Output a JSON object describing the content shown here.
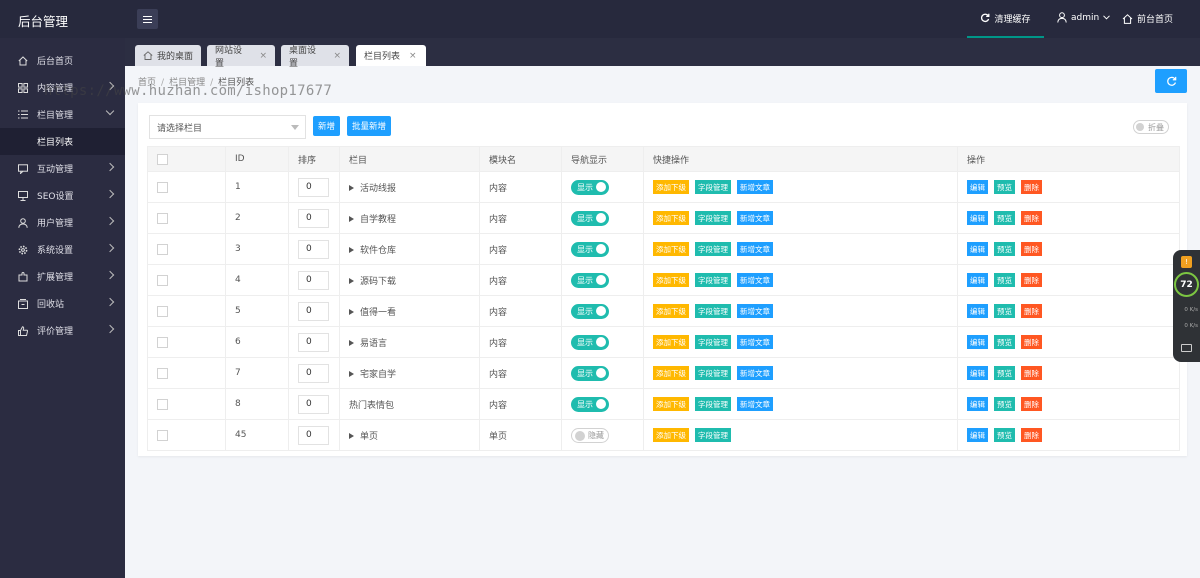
{
  "app": {
    "title": "后台管理"
  },
  "header": {
    "clear_cache": "清理缓存",
    "user": "admin",
    "front": "前台首页"
  },
  "sidebar": {
    "items": [
      {
        "label": "后台首页",
        "icon": "home-icon"
      },
      {
        "label": "内容管理",
        "icon": "grid-icon"
      },
      {
        "label": "栏目管理",
        "icon": "list-icon",
        "expanded": true
      },
      {
        "label": "互动管理",
        "icon": "chat-icon"
      },
      {
        "label": "SEO设置",
        "icon": "seo-icon"
      },
      {
        "label": "用户管理",
        "icon": "user-icon"
      },
      {
        "label": "系统设置",
        "icon": "gear-icon"
      },
      {
        "label": "扩展管理",
        "icon": "extension-icon"
      },
      {
        "label": "回收站",
        "icon": "recycle-icon"
      },
      {
        "label": "评价管理",
        "icon": "thumb-icon"
      }
    ],
    "sub_item": "栏目列表"
  },
  "tabs": [
    {
      "label": "我的桌面",
      "icon": "home-icon"
    },
    {
      "label": "网站设置"
    },
    {
      "label": "桌面设置"
    },
    {
      "label": "栏目列表",
      "active": true
    }
  ],
  "tab_close": "×",
  "breadcrumb": [
    "首页",
    "栏目管理",
    "栏目列表"
  ],
  "breadcrumb_sep": "/",
  "toolbar": {
    "select_placeholder": "请选择栏目",
    "add": "新增",
    "batch_add": "批量新增",
    "fold": "折叠"
  },
  "table": {
    "headers": [
      "ID",
      "排序",
      "栏目",
      "模块名",
      "导航显示",
      "快捷操作",
      "操作"
    ],
    "quick_actions": {
      "add_child": "添加下级",
      "field_manage": "字段管理",
      "new_article": "新增文章"
    },
    "actions": {
      "edit": "编辑",
      "preview": "预览",
      "delete": "删除"
    },
    "switch_on": "显示",
    "switch_off": "隐藏",
    "rows": [
      {
        "id": "1",
        "sort": "0",
        "name": "活动线报",
        "has_children": true,
        "module": "内容",
        "nav": "显示",
        "show_article": true
      },
      {
        "id": "2",
        "sort": "0",
        "name": "自学教程",
        "has_children": true,
        "module": "内容",
        "nav": "显示",
        "show_article": true
      },
      {
        "id": "3",
        "sort": "0",
        "name": "软件仓库",
        "has_children": true,
        "module": "内容",
        "nav": "显示",
        "show_article": true
      },
      {
        "id": "4",
        "sort": "0",
        "name": "源码下载",
        "has_children": true,
        "module": "内容",
        "nav": "显示",
        "show_article": true
      },
      {
        "id": "5",
        "sort": "0",
        "name": "值得一看",
        "has_children": true,
        "module": "内容",
        "nav": "显示",
        "show_article": true
      },
      {
        "id": "6",
        "sort": "0",
        "name": "易语言",
        "has_children": true,
        "module": "内容",
        "nav": "显示",
        "show_article": true
      },
      {
        "id": "7",
        "sort": "0",
        "name": "宅家自学",
        "has_children": true,
        "module": "内容",
        "nav": "显示",
        "show_article": true
      },
      {
        "id": "8",
        "sort": "0",
        "name": "热门表情包",
        "has_children": false,
        "module": "内容",
        "nav": "显示",
        "show_article": true
      },
      {
        "id": "45",
        "sort": "0",
        "name": "单页",
        "has_children": true,
        "module": "单页",
        "nav": "隐藏",
        "show_article": false
      }
    ]
  },
  "float_widget": {
    "badge": "!",
    "percent": "72",
    "up": "0 K/s",
    "down": "0 K/s"
  },
  "watermark": "https://www.huzhan.com/ishop17677",
  "colors": {
    "topbar": "#27293d",
    "sidebar": "#2b2c41",
    "accent": "#1e9fff",
    "teal": "#1fbcae",
    "orange": "#ffb800",
    "red": "#ff5722"
  }
}
